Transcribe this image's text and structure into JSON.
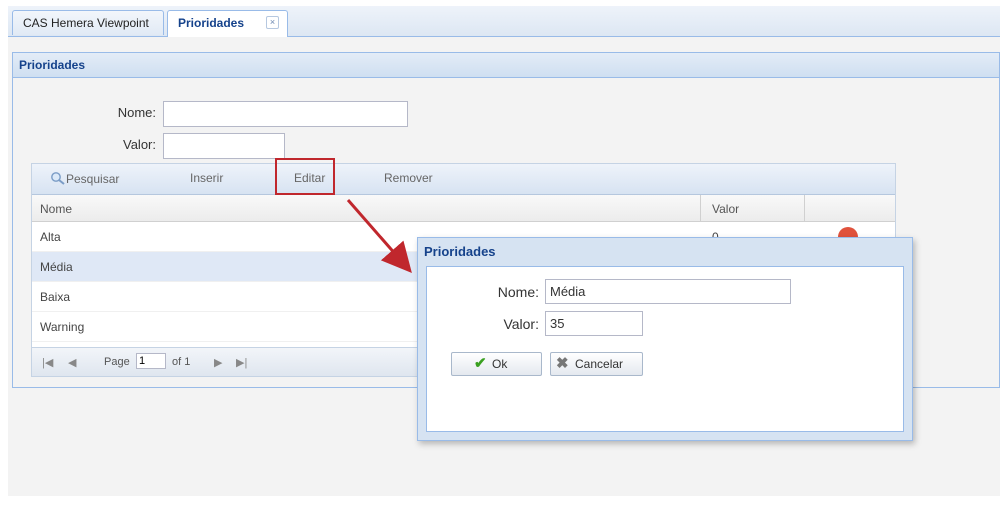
{
  "tabs": [
    {
      "label": "CAS Hemera Viewpoint",
      "active": false
    },
    {
      "label": "Prioridades",
      "active": true
    }
  ],
  "tab_close_glyph": "×",
  "panel": {
    "title": "Prioridades",
    "form": {
      "nome_label": "Nome:",
      "nome_value": "",
      "valor_label": "Valor:",
      "valor_value": ""
    }
  },
  "toolbar": {
    "search_label": "Pesquisar",
    "insert_label": "Inserir",
    "edit_label": "Editar",
    "remove_label": "Remover"
  },
  "grid": {
    "columns": [
      "Nome",
      "Valor"
    ],
    "rows": [
      {
        "nome": "Alta",
        "valor": "0"
      },
      {
        "nome": "Média",
        "valor": ""
      },
      {
        "nome": "Baixa",
        "valor": ""
      },
      {
        "nome": "Warning",
        "valor": ""
      }
    ],
    "pager": {
      "first": "|◀",
      "prev": "◀",
      "page_label": "Page",
      "page_value": "1",
      "of_label": "of 1",
      "next": "▶",
      "last": "▶|"
    }
  },
  "dialog": {
    "title": "Prioridades",
    "nome_label": "Nome:",
    "nome_value": "Média",
    "valor_label": "Valor:",
    "valor_value": "35",
    "ok_label": "Ok",
    "cancel_label": "Cancelar"
  },
  "colors": {
    "accent": "#15428b",
    "highlight": "#c0272d",
    "panel_border": "#99bbe8",
    "ok_check": "#3aa020",
    "status_dot": "#e0523c"
  },
  "icons": {
    "search": "magnifier-icon",
    "ok": "checkmark-icon",
    "cancel": "x-icon"
  }
}
